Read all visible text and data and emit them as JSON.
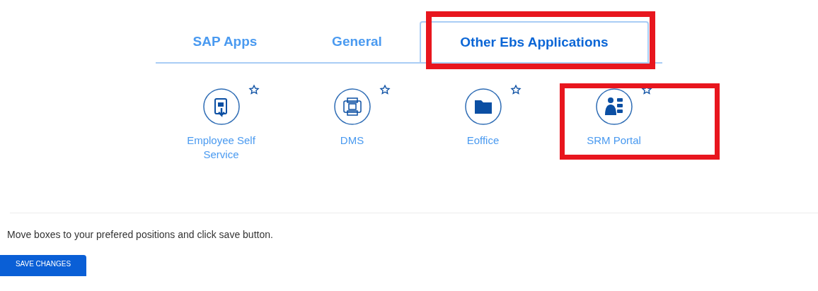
{
  "tabs": [
    {
      "label": "SAP Apps",
      "selected": false,
      "highlighted": false
    },
    {
      "label": "General",
      "selected": false,
      "highlighted": false
    },
    {
      "label": "Other Ebs Applications",
      "selected": true,
      "highlighted": true
    }
  ],
  "apps": [
    {
      "kind": "document",
      "label": "Employee Self Service",
      "highlighted": false
    },
    {
      "kind": "dms",
      "label": "DMS",
      "highlighted": false
    },
    {
      "kind": "folder",
      "label": "Eoffice",
      "highlighted": false
    },
    {
      "kind": "person",
      "label": "SRM Portal",
      "highlighted": true
    }
  ],
  "hint": "Move boxes to your prefered positions and click save button.",
  "save_button": "SAVE CHANGES"
}
